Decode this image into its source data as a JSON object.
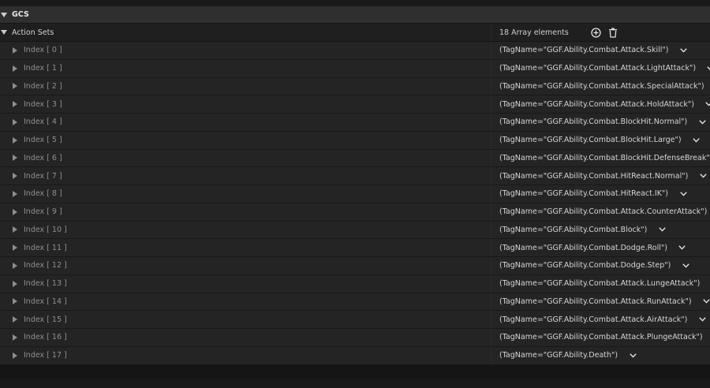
{
  "category": {
    "label": "GCS"
  },
  "action_sets": {
    "label": "Action Sets",
    "count_text": "18 Array elements",
    "icons": {
      "add": "add-element-icon",
      "clear": "trash-icon"
    }
  },
  "items": [
    {
      "index": "Index [ 0 ]",
      "value": "(TagName=\"GGF.Ability.Combat.Attack.Skill\")"
    },
    {
      "index": "Index [ 1 ]",
      "value": "(TagName=\"GGF.Ability.Combat.Attack.LightAttack\")"
    },
    {
      "index": "Index [ 2 ]",
      "value": "(TagName=\"GGF.Ability.Combat.Attack.SpecialAttack\")"
    },
    {
      "index": "Index [ 3 ]",
      "value": "(TagName=\"GGF.Ability.Combat.Attack.HoldAttack\")"
    },
    {
      "index": "Index [ 4 ]",
      "value": "(TagName=\"GGF.Ability.Combat.BlockHit.Normal\")"
    },
    {
      "index": "Index [ 5 ]",
      "value": "(TagName=\"GGF.Ability.Combat.BlockHit.Large\")"
    },
    {
      "index": "Index [ 6 ]",
      "value": "(TagName=\"GGF.Ability.Combat.BlockHit.DefenseBreak\")"
    },
    {
      "index": "Index [ 7 ]",
      "value": "(TagName=\"GGF.Ability.Combat.HitReact.Normal\")"
    },
    {
      "index": "Index [ 8 ]",
      "value": "(TagName=\"GGF.Ability.Combat.HitReact.IK\")"
    },
    {
      "index": "Index [ 9 ]",
      "value": "(TagName=\"GGF.Ability.Combat.Attack.CounterAttack\")"
    },
    {
      "index": "Index [ 10 ]",
      "value": "(TagName=\"GGF.Ability.Combat.Block\")"
    },
    {
      "index": "Index [ 11 ]",
      "value": "(TagName=\"GGF.Ability.Combat.Dodge.Roll\")"
    },
    {
      "index": "Index [ 12 ]",
      "value": "(TagName=\"GGF.Ability.Combat.Dodge.Step\")"
    },
    {
      "index": "Index [ 13 ]",
      "value": "(TagName=\"GGF.Ability.Combat.Attack.LungeAttack\")"
    },
    {
      "index": "Index [ 14 ]",
      "value": "(TagName=\"GGF.Ability.Combat.Attack.RunAttack\")"
    },
    {
      "index": "Index [ 15 ]",
      "value": "(TagName=\"GGF.Ability.Combat.Attack.AirAttack\")"
    },
    {
      "index": "Index [ 16 ]",
      "value": "(TagName=\"GGF.Ability.Combat.Attack.PlungeAttack\")"
    },
    {
      "index": "Index [ 17 ]",
      "value": "(TagName=\"GGF.Ability.Death\")"
    }
  ],
  "colors": {
    "background": "#151515",
    "row": "#242424",
    "category": "#2f2f2f",
    "text": "#d6d6d6",
    "muted_text": "#8f8f8f"
  }
}
